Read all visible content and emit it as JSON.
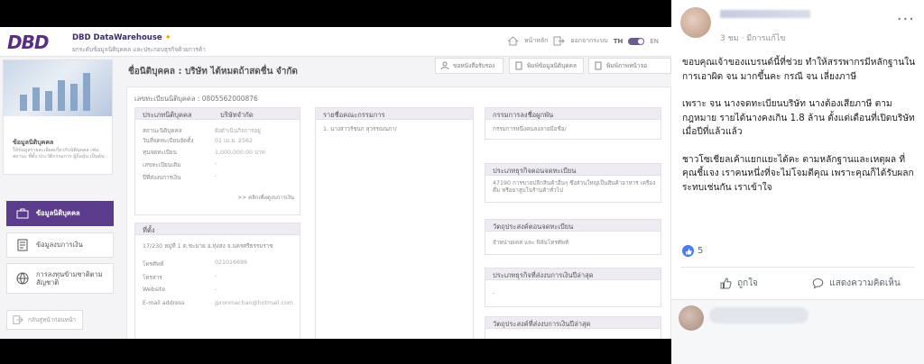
{
  "dbd": {
    "logo": "DBD",
    "app_title": "DBD DataWarehouse",
    "app_subtitle": "ยกระดับข้อมูลนิติบุคคล และประกอบธุรกิจด้วยการค้า",
    "home_label": "หน้าหลัก",
    "logout_label": "ออกจากระบบ",
    "lang_th": "TH",
    "lang_en": "EN",
    "sidebar": {
      "card_title": "ข้อมูลนิติบุคคล",
      "card_desc": "ให้ข้อมูลรายละเอียดเกี่ยวกับนิติบุคคล เช่น สถานะ ที่ตั้ง ประวัติกรรมการ ผู้ถือหุ้น เป็นต้น",
      "items": [
        {
          "label": "ข้อมูลนิติบุคคล",
          "icon": "briefcase-icon"
        },
        {
          "label": "ข้อมูลงบการเงิน",
          "icon": "document-icon"
        },
        {
          "label": "การลงทุนข้ามชาติตามสัญชาติ",
          "icon": "globe-icon"
        }
      ],
      "back_label": "กลับสู่หน้าก่อนหน้า"
    },
    "company_title": "ชื่อนิติบุคคล : บริษัท ไต้หมดถ้าสดชื่น จำกัด",
    "buttons": [
      "ขอหนังสือรับรอง",
      "พิมพ์ข้อมูลนิติบุคคล",
      "พิมพ์ภาพหน้าจอ"
    ],
    "reg_no_label": "เลขทะเบียนนิติบุคคล : 0805562000876",
    "type_box": {
      "title": "ประเภทนิติบุคคล",
      "value": "บริษัทจำกัด",
      "rows": [
        {
          "label": "สถานะนิติบุคคล",
          "value": "ยังดำเนินกิจการอยู่"
        },
        {
          "label": "วันที่จดทะเบียนจัดตั้ง",
          "value": "01 เม.ย. 2562"
        },
        {
          "label": "ทุนจดทะเบียน",
          "value": "1,000,000.00 บาท"
        },
        {
          "label": "เลขทะเบียนเดิม",
          "value": "-"
        },
        {
          "label": "ปีที่ส่งงบการเงิน",
          "value": "-"
        }
      ],
      "more_link": ">> คลิกเพื่อดูงบการเงิน"
    },
    "address_box": {
      "title": "ที่ตั้ง",
      "address": "17/230 หมู่ที่ 1 ต.ชะมาย อ.ทุ่งสง จ.นครศรีธรรมราช",
      "rows": [
        {
          "label": "โทรศัพท์",
          "value": "021016699"
        },
        {
          "label": "โทรสาร",
          "value": "-"
        },
        {
          "label": "Website",
          "value": "-"
        },
        {
          "label": "E-mail address",
          "value": "jpronmachan@hotmail.com"
        }
      ]
    },
    "directors_box": {
      "title": "รายชื่อคณะกรรมการ",
      "items": [
        "1. นางสาวรัชนก สุวรรณนภา/"
      ]
    },
    "signing_box": {
      "title": "กรรมการลงชื่อผูกพัน",
      "text": "กรรมการหนึ่งคนลงลายมือชื่อ/"
    },
    "business_box": {
      "title": "ประเภทธุรกิจตอนจดทะเบียน",
      "text": "47190 การขายปลีกสินค้าอื่นๆ ซึ่งส่วนใหญ่เป็นสินค้าอาหาร เครื่องดื่ม หรือยาสูบในร้านค้าทั่วไป"
    },
    "objective_box": {
      "title": "วัตถุประสงค์ตอนจดทะเบียน",
      "text": "จำหน่ายเคส และ ฟิล์มโทรศัพท์"
    },
    "latest_business_box": {
      "title": "ประเภทธุรกิจที่ส่งงบการเงินปีล่าสุด",
      "text": "-"
    },
    "latest_objective_box": {
      "title": "วัตถุประสงค์ที่ส่งงบการเงินปีล่าสุด"
    }
  },
  "fb": {
    "time_ago": "3 ชม",
    "edited": "มีการแก้ไข",
    "more": "...",
    "paragraphs": [
      "ขอบคุณเจ้าของแบรนด์นี้ที่ช่วย ทำให้สรรพากรมีหลักฐานในการเอาผิด จน มากขึ้นคะ กรณี จน เลี่ยงภาษี",
      "เพราะ จน นางจดทะเบียนบริษัท นางต้องเสียภาษี ตามกฎหมาย รายได้นางคงเกิน 1.8 ล้าน ตั้งแต่เดือนที่เปิดบริษัท เมื่อปีที่แล้วแล้ว",
      "ชาวโซเชียลเค้าแยกแยะได้คะ ตามหลักฐานและเหตุผล ที่คุณชี้แจง เราคนหนึ่งที่จะไม่โจมตีคุณ เพราะคุณก็ได้รับผลกระทบเช่นกัน เราเข้าใจ"
    ],
    "reaction_count": "5",
    "like_label": "ถูกใจ",
    "comment_label": "แสดงความคิดเห็น",
    "colors": {
      "accent": "#4267b2",
      "dbd_purple": "#5b3b8c"
    }
  }
}
